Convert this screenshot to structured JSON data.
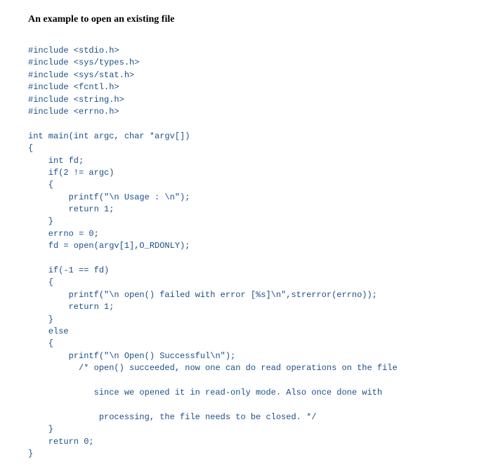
{
  "heading": "An example to open an existing file",
  "code": {
    "lines": [
      "#include <stdio.h>",
      "#include <sys/types.h>",
      "#include <sys/stat.h>",
      "#include <fcntl.h>",
      "#include <string.h>",
      "#include <errno.h>",
      "",
      "int main(int argc, char *argv[])",
      "{",
      "    int fd;",
      "    if(2 != argc)",
      "    {",
      "        printf(\"\\n Usage : \\n\");",
      "        return 1;",
      "    }",
      "    errno = 0;",
      "    fd = open(argv[1],O_RDONLY);",
      "",
      "    if(-1 == fd)",
      "    {",
      "        printf(\"\\n open() failed with error [%s]\\n\",strerror(errno));",
      "        return 1;",
      "    }",
      "    else",
      "    {",
      "        printf(\"\\n Open() Successful\\n\");",
      "          /* open() succeeded, now one can do read operations on the file",
      "",
      "             since we opened it in read-only mode. Also once done with",
      "",
      "              processing, the file needs to be closed. */",
      "    }",
      "    return 0;",
      "}"
    ]
  }
}
